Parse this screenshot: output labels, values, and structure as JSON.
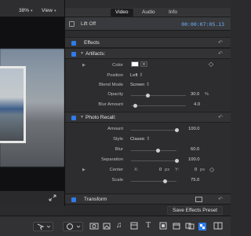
{
  "viewer": {
    "zoom": "38%",
    "view_label": "View"
  },
  "inspector": {
    "tabs": [
      "Video",
      "Audio",
      "Info"
    ],
    "active_tab": "Video",
    "clip_name": "Lift Off",
    "timecode": "00:00:07:05.13",
    "effects_label": "Effects",
    "artifacts": {
      "title": "Artifacts:",
      "color_label": "Color",
      "position_label": "Position",
      "position_value": "Left",
      "blend_label": "Blend Mode",
      "blend_value": "Screen",
      "opacity_label": "Opacity",
      "opacity_value": "30.0",
      "opacity_unit": "%",
      "opacity_level": 0.3,
      "blur_label": "Blur Amount",
      "blur_value": "4.0",
      "blur_level": 0.08
    },
    "photo_recall": {
      "title": "Photo Recall:",
      "amount_label": "Amount",
      "amount_value": "100.0",
      "amount_level": 1.0,
      "style_label": "Style",
      "style_value": "Classic",
      "blur_label": "Blur",
      "blur_value": "60.0",
      "blur_level": 0.6,
      "separation_label": "Separation",
      "separation_value": "100.0",
      "separation_level": 1.0,
      "center_label": "Center",
      "center_x_label": "X:",
      "center_x_value": "0",
      "center_x_unit": "px",
      "center_y_label": "Y:",
      "center_y_value": "0",
      "center_y_unit": "px",
      "scale_label": "Scale",
      "scale_value": "75.0",
      "scale_level": 0.75
    },
    "transform_label": "Transform",
    "save_preset_label": "Save Effects Preset"
  },
  "colors": {
    "accent": "#2f7bea",
    "timecode": "#6fb0ff"
  }
}
